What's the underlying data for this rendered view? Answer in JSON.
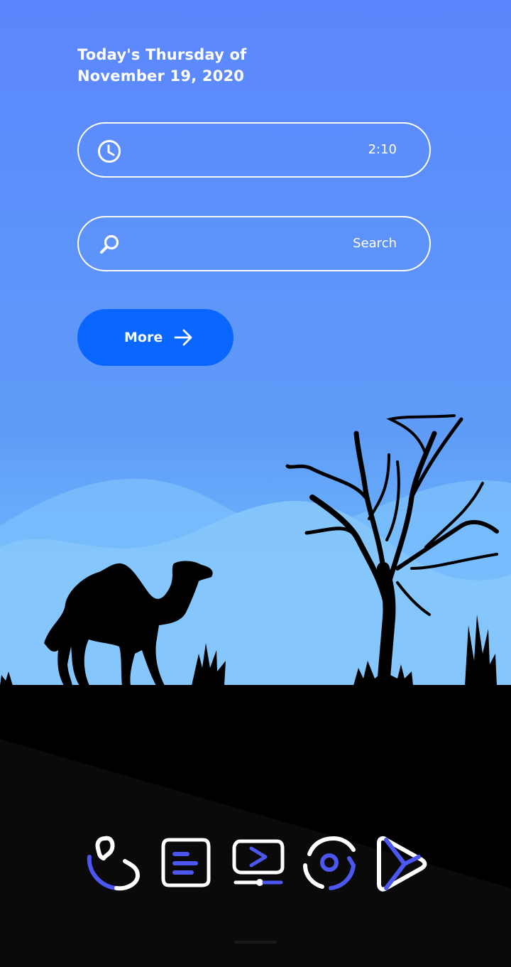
{
  "date": {
    "line1": "Today's Thursday of",
    "line2": "November 19, 2020"
  },
  "clock_widget": {
    "time": "2:10",
    "icon": "clock-icon"
  },
  "search_widget": {
    "placeholder": "Search",
    "icon": "search-icon"
  },
  "more_button": {
    "label": "More",
    "icon": "arrow-right-icon"
  },
  "dock": {
    "apps": [
      {
        "icon": "phone-app-icon"
      },
      {
        "icon": "messages-app-icon"
      },
      {
        "icon": "video-app-icon"
      },
      {
        "icon": "camera-app-icon"
      },
      {
        "icon": "play-store-icon"
      }
    ]
  },
  "colors": {
    "accent": "#0966ff",
    "icon_accent": "#4b57f0",
    "text": "#ffffff"
  }
}
